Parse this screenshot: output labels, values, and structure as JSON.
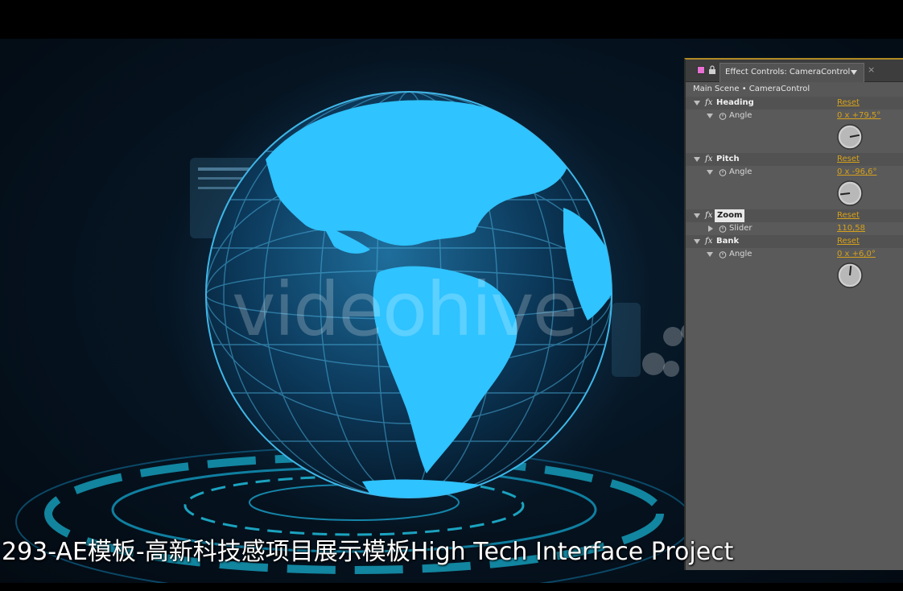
{
  "panel": {
    "tab_title": "Effect Controls: CameraControl",
    "tab_close": "×",
    "breadcrumb": "Main Scene • CameraControl",
    "reset_label": "Reset",
    "effects": [
      {
        "name": "Heading",
        "properties": [
          {
            "name": "Angle",
            "value": "0 x +79,5°",
            "dial_degrees": 79.5
          }
        ]
      },
      {
        "name": "Pitch",
        "properties": [
          {
            "name": "Angle",
            "value": "0 x -96,6°",
            "dial_degrees": -96.6
          }
        ]
      },
      {
        "name": "Zoom",
        "selected": true,
        "properties": [
          {
            "name": "Slider",
            "value": "110,58"
          }
        ]
      },
      {
        "name": "Bank",
        "properties": [
          {
            "name": "Angle",
            "value": "0 x +6,0°",
            "dial_degrees": 6.0
          }
        ]
      }
    ]
  },
  "watermark": "videohive",
  "subtitle": "293-AE模板-高新科技感项目展示模板High Tech Interface Project",
  "colors": {
    "panel_bg": "#5a5a5a",
    "accent_value": "#d6a11c",
    "globe_cyan": "#2fc3ff",
    "label_chip": "#e86fd4"
  }
}
